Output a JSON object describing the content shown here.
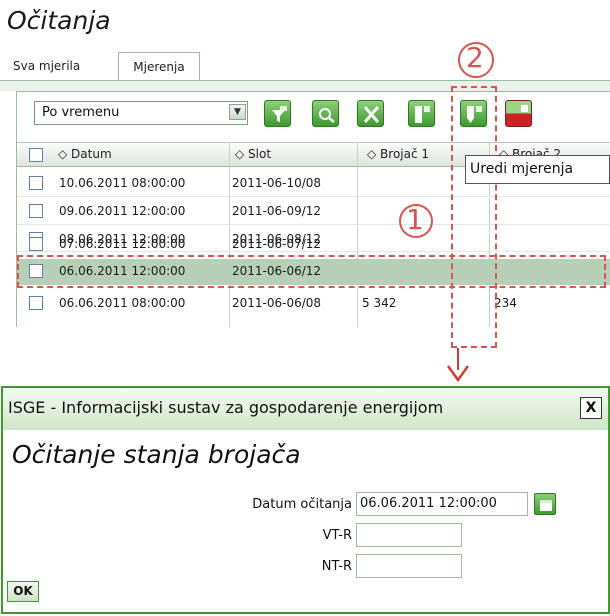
{
  "app": {
    "title": "Očitanja"
  },
  "tabs": [
    {
      "label": "Sva mjerila",
      "active": false
    },
    {
      "label": "Mjerenja",
      "active": true
    }
  ],
  "toolbar": {
    "view_select": {
      "value": "Po vremenu"
    },
    "buttons": [
      {
        "icon": "filter-icon"
      },
      {
        "icon": "search-icon"
      },
      {
        "icon": "excel-icon"
      },
      {
        "icon": "columns-icon"
      },
      {
        "icon": "edit-measurement-icon"
      },
      {
        "icon": "delete-icon"
      }
    ],
    "tooltip": "Uredi mjerenja"
  },
  "table": {
    "columns": [
      "Datum",
      "Slot",
      "Brojač 1",
      "Brojač 2"
    ],
    "rows": [
      {
        "datum": "10.06.2011 08:00:00",
        "slot": "2011-06-10/08",
        "b1": "",
        "b2": ""
      },
      {
        "datum": "09.06.2011 12:00:00",
        "slot": "2011-06-09/12",
        "b1": "",
        "b2": ""
      },
      {
        "datum": "08.06.2011 12:00:00",
        "slot": "2011-06-08/12",
        "b1": "",
        "b2": ""
      },
      {
        "datum": "07.06.2011 12:00:00",
        "slot": "2011-06-07/12",
        "b1": "",
        "b2": ""
      },
      {
        "datum": "06.06.2011 12:00:00",
        "slot": "2011-06-06/12",
        "b1": "",
        "b2": "",
        "selected": true
      },
      {
        "datum": "06.06.2011 08:00:00",
        "slot": "2011-06-06/08",
        "b1": "5 342",
        "b2": "234"
      }
    ]
  },
  "callouts": {
    "one": "1",
    "two": "2"
  },
  "colors": {
    "accent_green": "#3e9a2c",
    "highlight_red": "#d9534f",
    "selected_row": "#b7cfb7"
  },
  "dialog": {
    "title": "ISGE - Informacijski sustav za gospodarenje energijom",
    "close_label": "X",
    "heading": "Očitanje stanja brojača",
    "fields": {
      "date_label": "Datum očitanja",
      "date_value": "06.06.2011 12:00:00",
      "vtr_label": "VT-R",
      "vtr_value": "",
      "ntr_label": "NT-R",
      "ntr_value": ""
    },
    "ok_label": "OK"
  }
}
